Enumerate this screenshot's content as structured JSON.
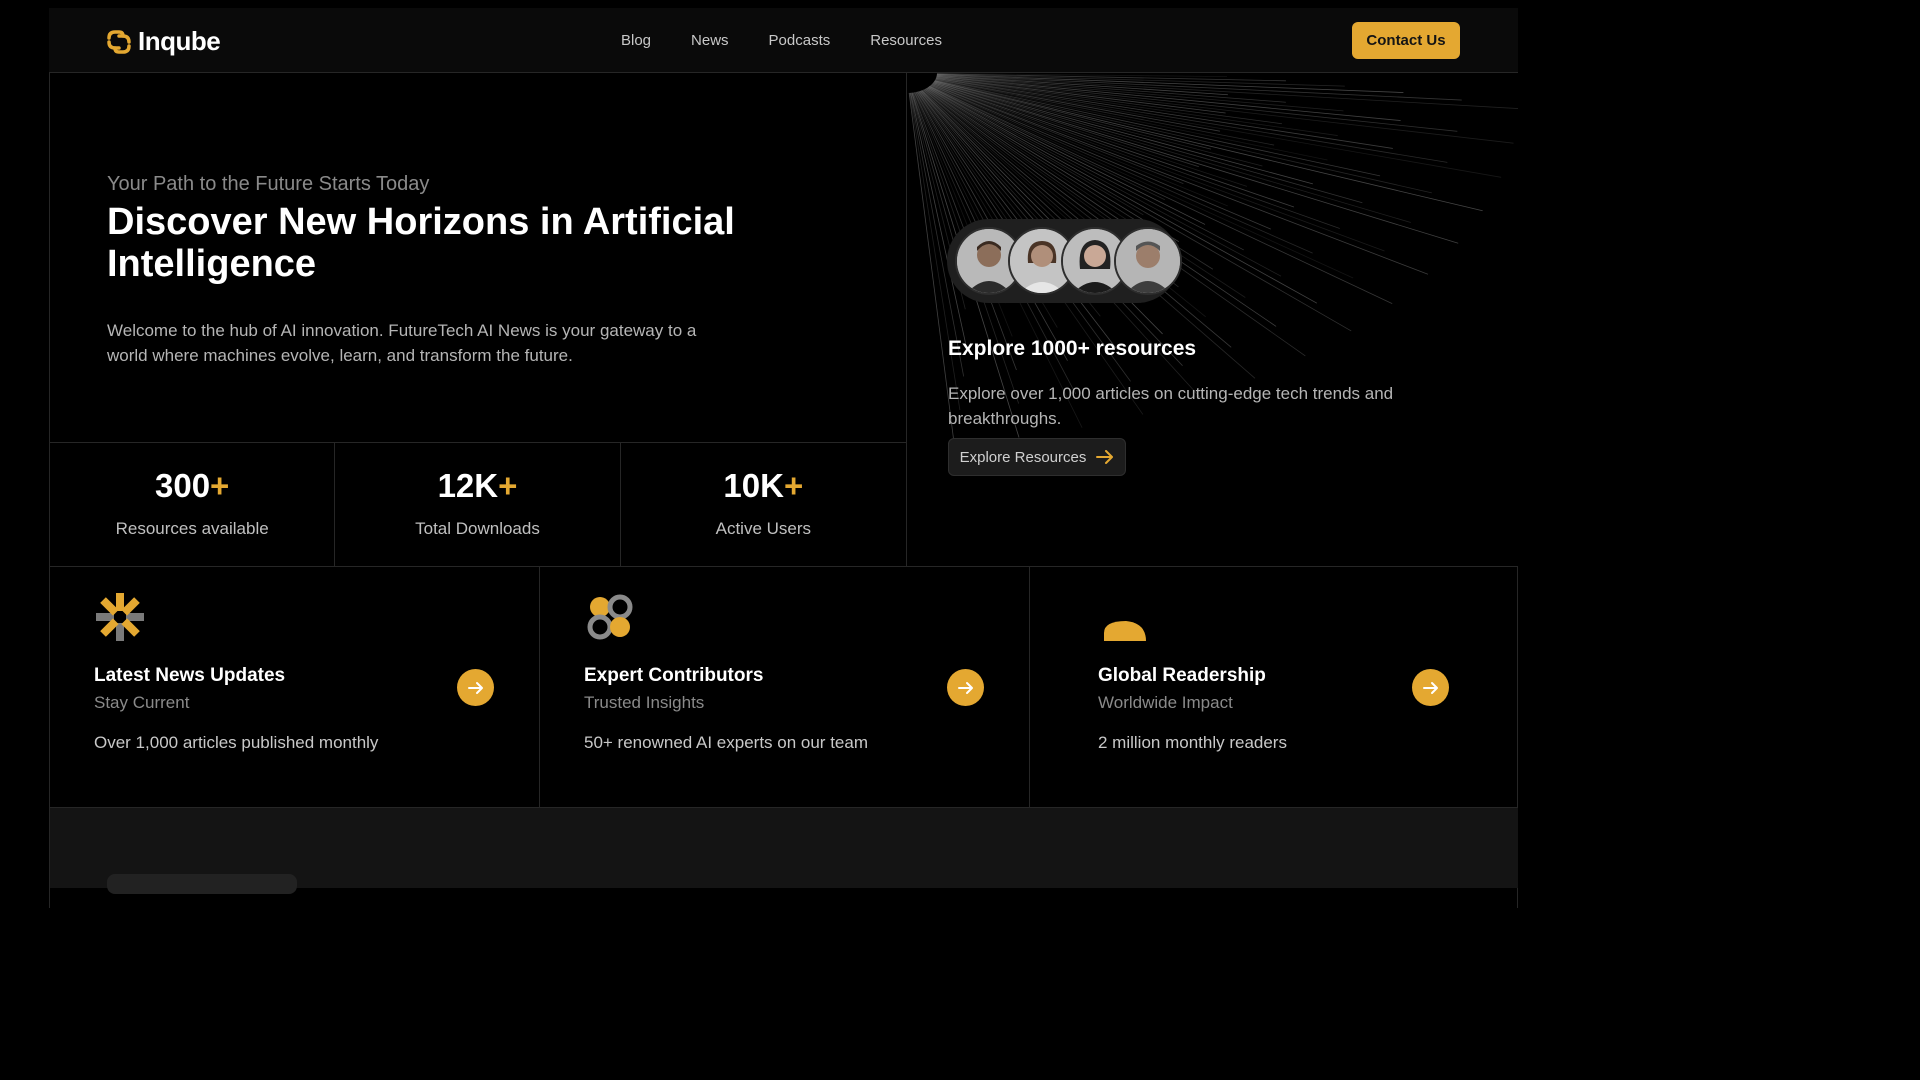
{
  "nav": {
    "brand": "Inqube",
    "links": [
      {
        "label": "Blog"
      },
      {
        "label": "News"
      },
      {
        "label": "Podcasts"
      },
      {
        "label": "Resources"
      }
    ],
    "cta": "Contact Us"
  },
  "hero": {
    "tagline": "Your Path to the Future Starts Today",
    "title": "Discover New Horizons in Artificial Intelligence",
    "description": "Welcome to the hub of AI innovation. FutureTech AI News is your gateway to a world where machines evolve, learn, and transform the future."
  },
  "stats": [
    {
      "value": "300",
      "suffix": "+",
      "label": "Resources available"
    },
    {
      "value": "12K",
      "suffix": "+",
      "label": "Total Downloads"
    },
    {
      "value": "10K",
      "suffix": "+",
      "label": "Active Users"
    }
  ],
  "explore": {
    "title": "Explore 1000+ resources",
    "description": "Explore over 1,000 articles on cutting-edge tech trends and breakthroughs.",
    "button": "Explore Resources"
  },
  "features": [
    {
      "title": "Latest News Updates",
      "subtitle": "Stay Current",
      "description": "Over 1,000 articles published monthly",
      "icon": "asterisk-icon"
    },
    {
      "title": "Expert Contributors",
      "subtitle": "Trusted Insights",
      "description": "50+ renowned AI experts on our team",
      "icon": "clover-icon"
    },
    {
      "title": "Global Readership",
      "subtitle": "Worldwide Impact",
      "description": "2 million monthly readers",
      "icon": "half-circle-icon"
    }
  ],
  "colors": {
    "accent": "#e4a831",
    "background": "#000000",
    "border": "#262626"
  }
}
